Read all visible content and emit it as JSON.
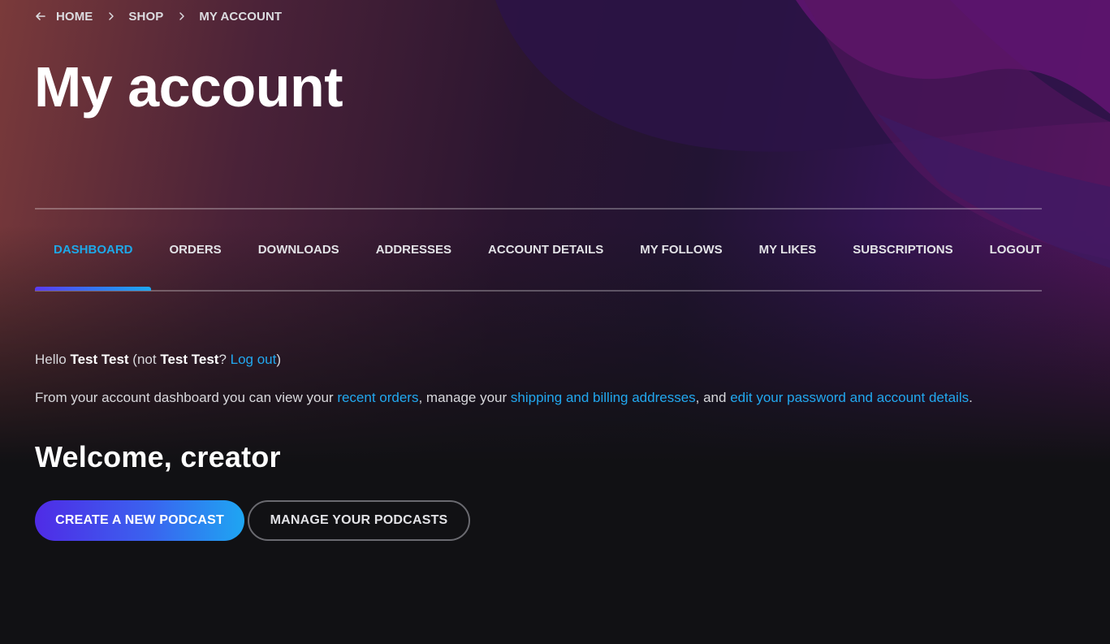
{
  "breadcrumb": {
    "back_icon": "arrow-left-icon",
    "separator_icon": "chevron-right-icon",
    "items": [
      "HOME",
      "SHOP",
      "MY ACCOUNT"
    ]
  },
  "page_title": "My account",
  "tabs": [
    {
      "label": "DASHBOARD",
      "active": true
    },
    {
      "label": "ORDERS",
      "active": false
    },
    {
      "label": "DOWNLOADS",
      "active": false
    },
    {
      "label": "ADDRESSES",
      "active": false
    },
    {
      "label": "ACCOUNT DETAILS",
      "active": false
    },
    {
      "label": "MY FOLLOWS",
      "active": false
    },
    {
      "label": "MY LIKES",
      "active": false
    },
    {
      "label": "SUBSCRIPTIONS",
      "active": false
    },
    {
      "label": "LOGOUT",
      "active": false
    }
  ],
  "greeting": {
    "hello": "Hello ",
    "user_name": "Test Test",
    "not_prefix": " (not ",
    "not_name": "Test Test",
    "question": "? ",
    "logout_link": "Log out",
    "close": ")"
  },
  "dashboard_text": {
    "part1": "From your account dashboard you can view your ",
    "link_orders": "recent orders",
    "part2": ", manage your ",
    "link_addresses": "shipping and billing addresses",
    "part3": ", and ",
    "link_account": "edit your password and account details",
    "part4": "."
  },
  "welcome_heading": "Welcome, creator",
  "buttons": {
    "create_podcast": "CREATE A NEW PODCAST",
    "manage_podcasts": "MANAGE YOUR PODCASTS"
  },
  "colors": {
    "accent": "#1ea8e8",
    "link": "#22a8ef",
    "background": "#111114",
    "primary_button_start": "#4f2be6",
    "primary_button_end": "#1ea6f2"
  }
}
